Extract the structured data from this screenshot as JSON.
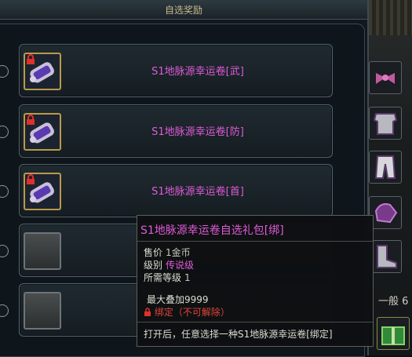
{
  "window": {
    "title": "自选奖励"
  },
  "rewards": [
    {
      "label": "S1地脉源幸运卷[武]",
      "locked": true,
      "has_item": true
    },
    {
      "label": "S1地脉源幸运卷[防]",
      "locked": true,
      "has_item": true
    },
    {
      "label": "S1地脉源幸运卷[首]",
      "locked": true,
      "has_item": true
    },
    {
      "label": "",
      "locked": false,
      "has_item": false
    },
    {
      "label": "",
      "locked": false,
      "has_item": false
    }
  ],
  "tooltip": {
    "title": "S1地脉源幸运卷自选礼包[绑]",
    "price_key": "售价",
    "price_value": "1金币",
    "grade_key": "级别",
    "grade_value": "传说级",
    "level_key": "所需等级",
    "level_value": "1",
    "stack": "最大叠加9999",
    "bind_text": "绑定（不可解除）",
    "description": "打开后，任意选择一种S1地脉源幸运卷[绑定]"
  },
  "inventory": {
    "tab_label": "一般 6"
  },
  "colors": {
    "legendary": "#e05ad8",
    "bound": "#e0443a",
    "slot_border": "#b99a48"
  }
}
